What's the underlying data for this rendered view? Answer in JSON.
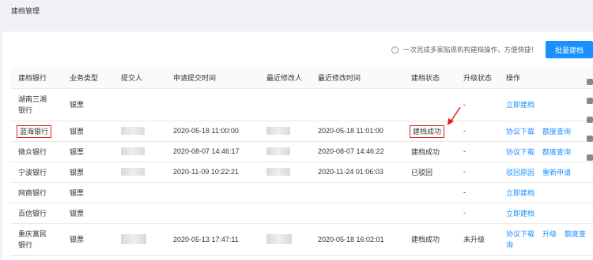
{
  "page": {
    "title": "建档管理"
  },
  "toolbar": {
    "hint": "一次完成多家贴现机构建档操作，方便快捷！",
    "batch_button": "批量建档"
  },
  "table": {
    "headers": [
      "建档银行",
      "业务类型",
      "提交人",
      "申请提交时间",
      "最近修改人",
      "最近修改时间",
      "建档状态",
      "升级状态",
      "操作"
    ],
    "rows": [
      {
        "bank": "湖南三湘\n银行",
        "biz": "银票",
        "submit_time": "",
        "modify_time": "",
        "status": "",
        "upgrade": "-",
        "actions": [
          "立即建档"
        ]
      },
      {
        "bank": "蓝海银行",
        "biz": "银票",
        "submit_time": "2020-05-18 11:00:00",
        "modify_time": "2020-05-18 11:01:00",
        "status": "建档成功",
        "upgrade": "-",
        "actions": [
          "协议下载",
          "额度查询"
        ]
      },
      {
        "bank": "微众银行",
        "biz": "银票",
        "submit_time": "2020-08-07 14:46:17",
        "modify_time": "2020-08-07 14:46:22",
        "status": "建档成功",
        "upgrade": "-",
        "actions": [
          "协议下载",
          "额度查询"
        ]
      },
      {
        "bank": "宁波银行",
        "biz": "银票",
        "submit_time": "2020-11-09 10:22:21",
        "modify_time": "2020-11-24 01:06:03",
        "status": "已驳回",
        "upgrade": "-",
        "actions": [
          "驳回原因",
          "重新申请"
        ]
      },
      {
        "bank": "网商银行",
        "biz": "银票",
        "submit_time": "",
        "modify_time": "",
        "status": "",
        "upgrade": "-",
        "actions": [
          "立即建档"
        ]
      },
      {
        "bank": "百信银行",
        "biz": "银票",
        "submit_time": "",
        "modify_time": "",
        "status": "",
        "upgrade": "-",
        "actions": [
          "立即建档"
        ]
      },
      {
        "bank": "重庆富民\n银行",
        "biz": "银票",
        "submit_time": "2020-05-13 17:47:11",
        "modify_time": "2020-05-18 16:02:01",
        "status": "建档成功",
        "upgrade": "未升级",
        "actions": [
          "协议下载",
          "升级",
          "额度查询"
        ]
      }
    ]
  }
}
